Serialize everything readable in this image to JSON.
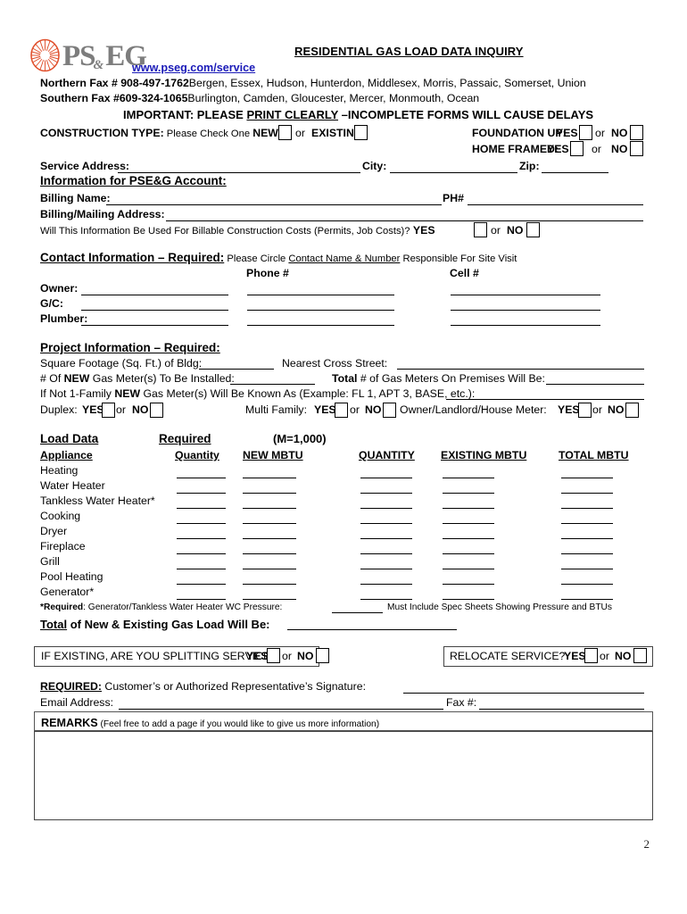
{
  "brand": {
    "logo_text": "PSEG",
    "logo_color": "#E04E2A",
    "logo_word_color": "#7d7d7d",
    "website": "www.pseg.com/service"
  },
  "header": {
    "title": "RESIDENTIAL GAS LOAD DATA INQUIRY",
    "northern_fax_label": "Northern Fax # 908-497-1762",
    "northern_fax_counties": "Bergen, Essex, Hudson, Hunterdon, Middlesex, Morris, Passaic, Somerset, Union",
    "southern_fax_label": "Southern Fax #609-324-1065",
    "southern_fax_counties": "Burlington, Camden, Gloucester, Mercer, Monmouth, Ocean",
    "important_pre": "IMPORTANT: PLEASE ",
    "important_underlined": "PRINT CLEARLY",
    "important_post": " –INCOMPLETE FORMS WILL CAUSE DELAYS"
  },
  "construction": {
    "label": "CONSTRUCTION TYPE:",
    "instruction": " Please Check One ",
    "new_label": "NEW",
    "or_label": "or",
    "existing_label": "EXISTING",
    "foundation_label": "FOUNDATION UP:",
    "home_framed_label": "HOME FRAMED:",
    "yes_label": "YES",
    "no_label": "NO"
  },
  "service": {
    "address_label": "Service Address:",
    "city_label": "City:",
    "zip_label": "Zip:"
  },
  "account": {
    "heading": "Information for PSE&G Account:",
    "billing_name_label": "Billing Name:",
    "phone_label": "PH#",
    "billing_address_label": "Billing/Mailing Address:",
    "billable_question": "Will This Information Be Used For Billable Construction Costs (Permits, Job Costs)?",
    "yes_label": "YES",
    "or_label": "or",
    "no_label": "NO"
  },
  "contact": {
    "heading": "Contact Information – Required:",
    "instruction_pre": " Please Circle ",
    "instruction_underlined": "Contact Name & Number",
    "instruction_post": " Responsible For Site Visit",
    "phone_col": "Phone #",
    "cell_col": "Cell #",
    "rows": [
      {
        "label": "Owner:"
      },
      {
        "label": "G/C:"
      },
      {
        "label": "Plumber:"
      }
    ]
  },
  "project": {
    "heading": "Project Information – Required:",
    "sqft_label": "Square Footage (Sq. Ft.) of Bldg:",
    "cross_street_label": "Nearest Cross Street:",
    "meters_pre": "# Of ",
    "meters_new": "NEW",
    "meters_post": " Gas Meter(s) To Be Installed:",
    "total_bold": "Total",
    "total_post": " # of Gas Meters On Premises Will Be:",
    "not_one_family_pre": "If Not 1-Family ",
    "not_one_family_new": "NEW",
    "not_one_family_post": " Gas Meter(s) Will Be Known As (Example: FL 1, APT 3, BASE, etc.):",
    "duplex_label": "Duplex:",
    "multifamily_label": "Multi Family:",
    "owner_meter_label": "Owner/Landlord/House Meter:",
    "yes_label": "YES",
    "or_label": "or",
    "no_label": "NO"
  },
  "load_data": {
    "heading": "Load Data",
    "required_label": "Required",
    "unit_note": "(M=1,000)",
    "columns": [
      "Appliance",
      "Quantity",
      "NEW MBTU",
      "QUANTITY",
      "EXISTING MBTU",
      "TOTAL MBTU"
    ],
    "appliances": [
      "Heating",
      "Water Heater",
      "Tankless Water Heater*",
      "Cooking",
      "Dryer",
      "Fireplace",
      "Grill",
      "Pool Heating",
      "Generator*"
    ],
    "required_note_bold": "*Required",
    "required_note_mid": ": Generator/Tankless Water Heater WC Pressure:",
    "required_note_end": "Must Include Spec Sheets Showing Pressure and BTUs",
    "total_underlined": "Total",
    "total_rest": " of New & Existing Gas Load Will Be:"
  },
  "bottom": {
    "splitting_question": "IF EXISTING, ARE YOU SPLITTING SERVICE?",
    "relocate_question": "RELOCATE SERVICE?",
    "yes_label": "YES",
    "or_label": "or",
    "no_label": "NO",
    "required_label": "REQUIRED:",
    "signature_label": " Customer’s or Authorized Representative’s Signature:",
    "email_label": "Email Address:",
    "fax_label": "Fax #:",
    "remarks_bold": "REMARKS",
    "remarks_note": " (Feel free to add a page if you would like to give us more information)"
  },
  "footer": {
    "page_number": "2"
  }
}
